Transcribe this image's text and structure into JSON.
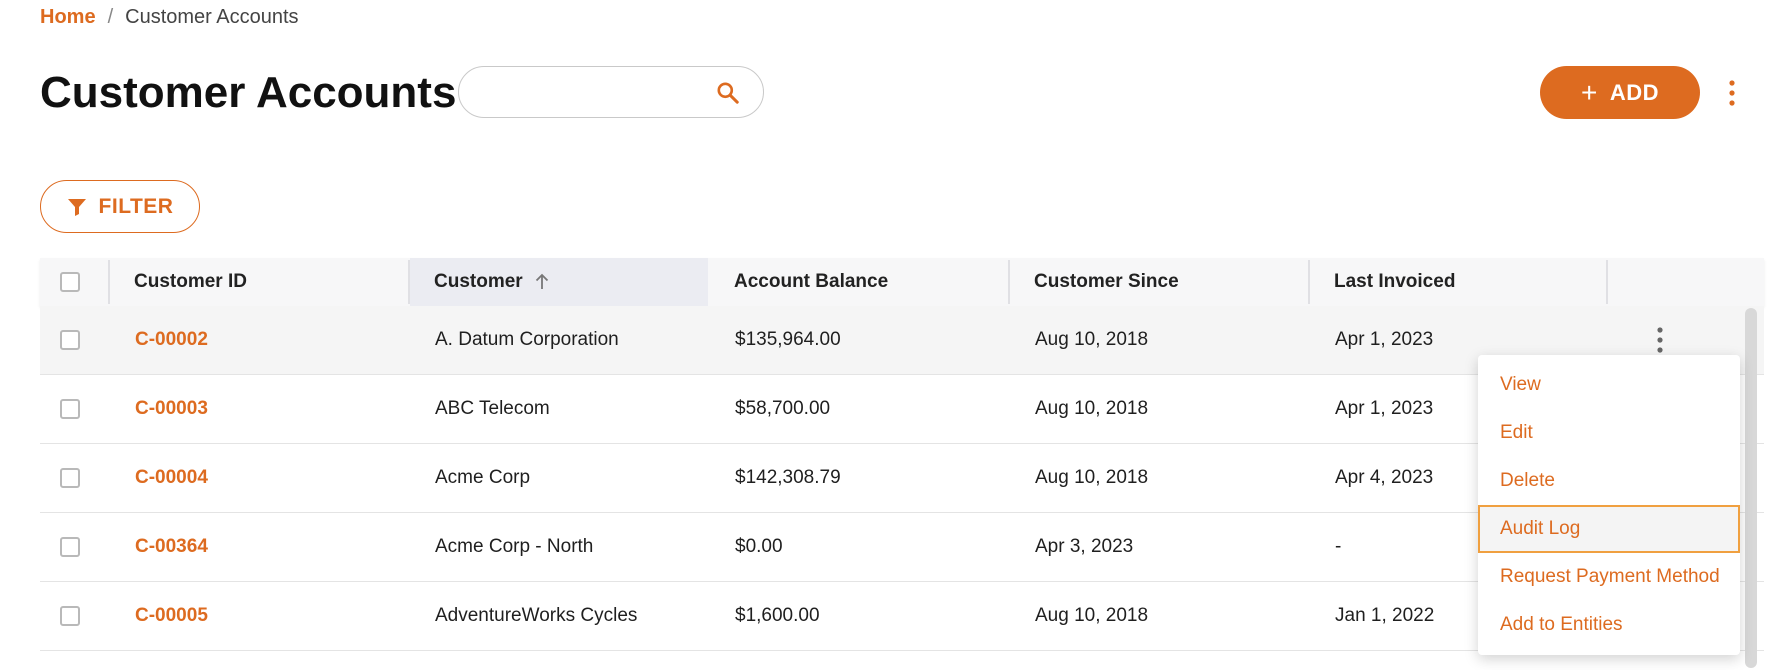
{
  "breadcrumb": {
    "home": "Home",
    "separator": "/",
    "current": "Customer Accounts"
  },
  "page": {
    "title": "Customer Accounts"
  },
  "search": {
    "placeholder": "",
    "value": ""
  },
  "toolbar": {
    "add_label": "ADD",
    "filter_label": "FILTER"
  },
  "colors": {
    "accent": "#dd6b20",
    "focus": "#f0a040"
  },
  "table": {
    "columns": [
      "Customer ID",
      "Customer",
      "Account Balance",
      "Customer Since",
      "Last Invoiced"
    ],
    "sorted_column": "Customer",
    "sort_direction": "ascending",
    "rows": [
      {
        "id": "C-00002",
        "customer": "A. Datum Corporation",
        "balance": "$135,964.00",
        "since": "Aug 10, 2018",
        "last_invoiced": "Apr 1, 2023"
      },
      {
        "id": "C-00003",
        "customer": "ABC Telecom",
        "balance": "$58,700.00",
        "since": "Aug 10, 2018",
        "last_invoiced": "Apr 1, 2023"
      },
      {
        "id": "C-00004",
        "customer": "Acme Corp",
        "balance": "$142,308.79",
        "since": "Aug 10, 2018",
        "last_invoiced": "Apr 4, 2023"
      },
      {
        "id": "C-00364",
        "customer": "Acme Corp - North",
        "balance": "$0.00",
        "since": "Apr 3, 2023",
        "last_invoiced": "-"
      },
      {
        "id": "C-00005",
        "customer": "AdventureWorks Cycles",
        "balance": "$1,600.00",
        "since": "Aug 10, 2018",
        "last_invoiced": "Jan 1, 2022"
      }
    ]
  },
  "context_menu": {
    "items": [
      "View",
      "Edit",
      "Delete",
      "Audit Log",
      "Request Payment Method",
      "Add to Entities"
    ],
    "focused_item": "Audit Log"
  }
}
